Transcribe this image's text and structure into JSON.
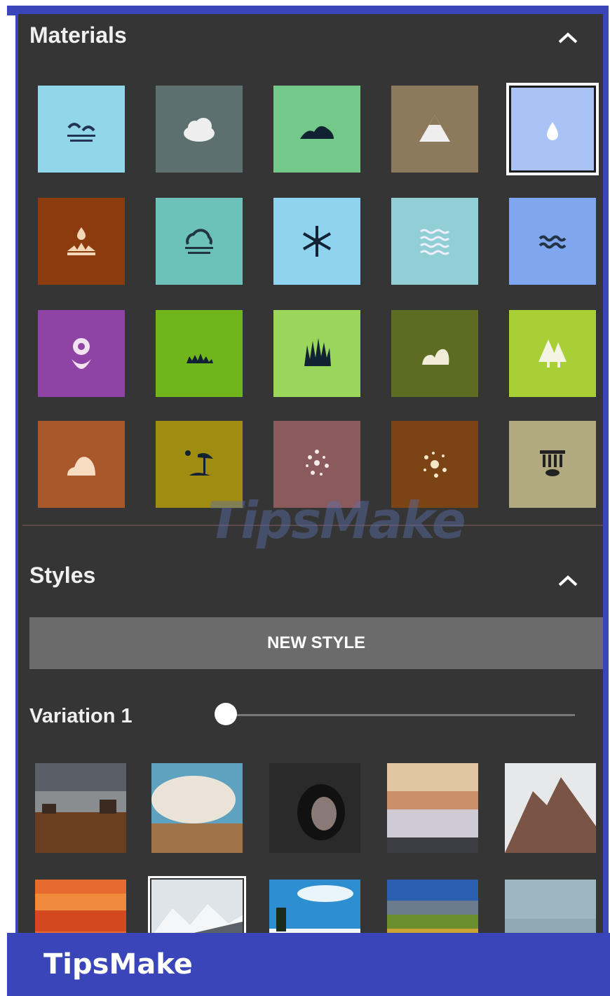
{
  "materials": {
    "title": "Materials",
    "tiles": [
      {
        "name": "beach-icon",
        "color": "#92d6ea"
      },
      {
        "name": "cloud-icon",
        "color": "#5e6f70"
      },
      {
        "name": "hills-icon",
        "color": "#74c98a"
      },
      {
        "name": "mountain-icon",
        "color": "#8d7a5d"
      },
      {
        "name": "water-drop-icon",
        "color": "#a9c3f6",
        "selected": true
      },
      {
        "name": "splash-icon",
        "color": "#8c3b0e"
      },
      {
        "name": "fog-icon",
        "color": "#6cc2b8"
      },
      {
        "name": "snowflake-icon",
        "color": "#8fd3ef"
      },
      {
        "name": "waves-icon",
        "color": "#90cfd3"
      },
      {
        "name": "water-icon",
        "color": "#7fa6ee"
      },
      {
        "name": "flower-icon",
        "color": "#8f44a5"
      },
      {
        "name": "grass-low-icon",
        "color": "#70b51c"
      },
      {
        "name": "grass-tall-icon",
        "color": "#9bd65c"
      },
      {
        "name": "rock-icon",
        "color": "#5e6b23"
      },
      {
        "name": "trees-icon",
        "color": "#a8cf36"
      },
      {
        "name": "boulder-icon",
        "color": "#a9582c"
      },
      {
        "name": "palm-tree-icon",
        "color": "#a08c10"
      },
      {
        "name": "sparkle-dots-icon",
        "color": "#8a5a5c"
      },
      {
        "name": "burst-icon",
        "color": "#7b4414"
      },
      {
        "name": "ruins-icon",
        "color": "#b1aa80"
      }
    ]
  },
  "styles": {
    "title": "Styles",
    "new_style_label": "NEW STYLE",
    "variation_label": "Variation 1",
    "variation_value": 0,
    "photos": [
      "desert-sky-photo",
      "cloud-desert-photo",
      "cave-photo",
      "mist-valley-photo",
      "rock-peak-photo",
      "sunset-photo",
      "snowy-mountains-photo",
      "blue-sky-photo",
      "green-field-photo",
      "calm-sea-photo"
    ]
  },
  "footer": {
    "brand": "TipsMake"
  },
  "watermark": "TipsMake"
}
